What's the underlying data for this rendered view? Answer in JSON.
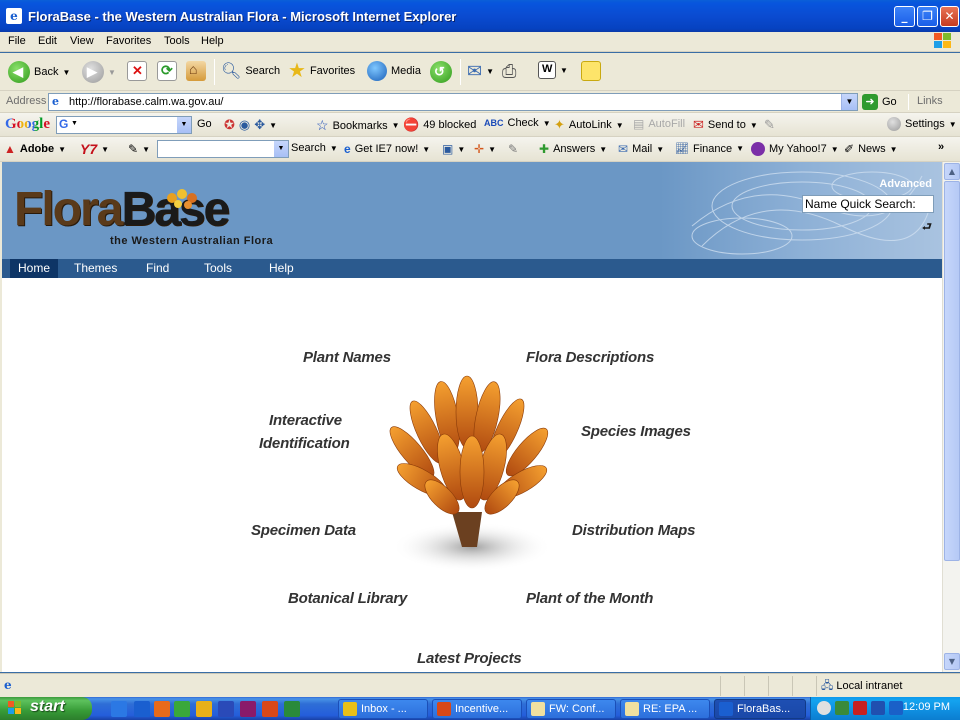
{
  "window": {
    "title": "FloraBase - the Western Australian Flora - Microsoft Internet Explorer",
    "controls": [
      "_",
      "❐",
      "✕"
    ]
  },
  "menu": [
    "File",
    "Edit",
    "View",
    "Favorites",
    "Tools",
    "Help"
  ],
  "standard_toolbar": {
    "back": "Back",
    "search": "Search",
    "favorites": "Favorites",
    "media": "Media"
  },
  "address_bar": {
    "label": "Address",
    "url": "http://florabase.calm.wa.gov.au/",
    "go": "Go",
    "links": "Links"
  },
  "google_toolbar": {
    "logo": "Google",
    "go": "Go",
    "bookmarks": "Bookmarks",
    "blocked": "49 blocked",
    "check": "Check",
    "autolink": "AutoLink",
    "autofill": "AutoFill",
    "send_to": "Send to",
    "settings": "Settings"
  },
  "yahoo_toolbar": {
    "adobe": "Adobe",
    "y7": "Y7",
    "search": "Search",
    "get_ie7": "Get IE7 now!",
    "answers": "Answers",
    "mail": "Mail",
    "finance": "Finance",
    "my_yahoo": "My Yahoo!7",
    "news": "News"
  },
  "florabase": {
    "logo_part1": "Flora",
    "logo_part2": "Base",
    "tagline": "the Western Australian Flora",
    "advanced": "Advanced",
    "quick_search_placeholder": "Name Quick Search:",
    "nav": [
      "Home",
      "Themes",
      "Find",
      "Tools",
      "Help"
    ],
    "links": {
      "plant_names": "Plant Names",
      "flora_descriptions": "Flora Descriptions",
      "interactive_identification_1": "Interactive",
      "interactive_identification_2": "Identification",
      "species_images": "Species Images",
      "specimen_data": "Specimen Data",
      "distribution_maps": "Distribution Maps",
      "botanical_library": "Botanical Library",
      "plant_of_the_month": "Plant of the Month",
      "latest_projects": "Latest Projects"
    }
  },
  "status_bar": {
    "zone": "Local intranet"
  },
  "taskbar": {
    "start": "start",
    "tasks": [
      "Inbox - ...",
      "Incentive...",
      "FW: Conf...",
      "RE: EPA ...",
      "FloraBas..."
    ],
    "clock": "12:09 PM"
  }
}
